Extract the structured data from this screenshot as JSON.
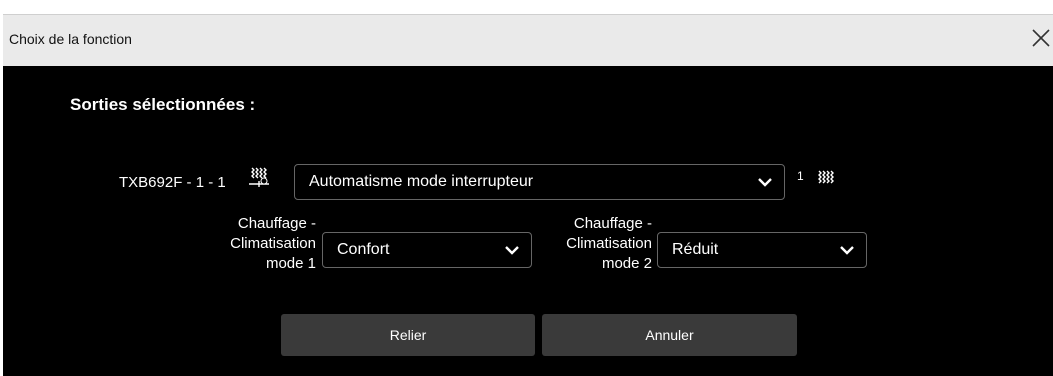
{
  "dialog": {
    "title": "Choix de la fonction",
    "close_icon": "close-icon"
  },
  "content": {
    "heading": "Sorties sélectionnées :",
    "output": {
      "device_label": "TXB692F - 1 - 1",
      "icon": "heating-output-icon",
      "function_select": "Automatisme mode interrupteur",
      "suffix_number": "1",
      "suffix_icon": "heating-icon"
    },
    "mode1": {
      "label_line1": "Chauffage -",
      "label_line2": "Climatisation",
      "label_line3": "mode 1",
      "value": "Confort"
    },
    "mode2": {
      "label_line1": "Chauffage -",
      "label_line2": "Climatisation",
      "label_line3": "mode 2",
      "value": "Réduit"
    }
  },
  "buttons": {
    "link": "Relier",
    "cancel": "Annuler"
  },
  "colors": {
    "background": "#000000",
    "titlebar": "#eaeaea",
    "button": "#3a3a3a",
    "select_border": "#666666"
  }
}
